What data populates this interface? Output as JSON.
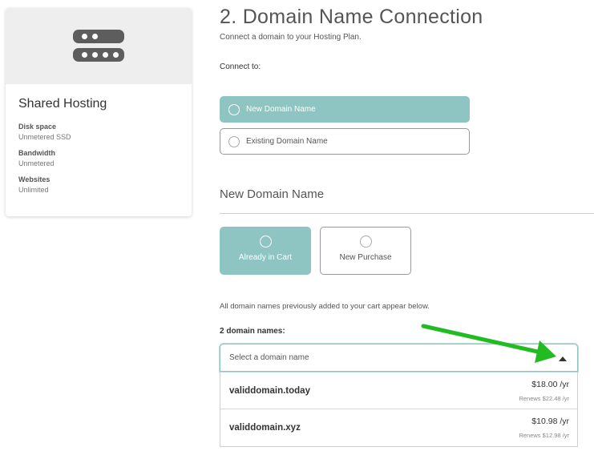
{
  "product": {
    "title": "Shared Hosting",
    "icon": "server-icon",
    "specs": [
      {
        "label": "Disk space",
        "value": "Unmetered SSD"
      },
      {
        "label": "Bandwidth",
        "value": "Unmetered"
      },
      {
        "label": "Websites",
        "value": "Unlimited"
      }
    ]
  },
  "step": {
    "title": "2. Domain Name Connection",
    "subtitle": "Connect a domain to your Hosting Plan.",
    "connect_label": "Connect to:",
    "connect_options": [
      {
        "label": "New Domain Name",
        "selected": true
      },
      {
        "label": "Existing Domain Name",
        "selected": false
      }
    ]
  },
  "new_domain": {
    "section_title": "New Domain Name",
    "source_options": [
      {
        "label": "Already in Cart",
        "selected": true
      },
      {
        "label": "New Purchase",
        "selected": false
      }
    ],
    "info_text": "All domain names previously added to your cart appear below.",
    "count_label": "2 domain names:",
    "select": {
      "placeholder": "Select a domain name",
      "expanded": true,
      "options": [
        {
          "name": "validdomain.today",
          "price": "$18.00 /yr",
          "renews": "Renews $22.48 /yr"
        },
        {
          "name": "validdomain.xyz",
          "price": "$10.98 /yr",
          "renews": "Renews $12.98 /yr"
        }
      ]
    }
  },
  "colors": {
    "accent": "#8ec5c2",
    "annotation_arrow": "#22bb22"
  }
}
